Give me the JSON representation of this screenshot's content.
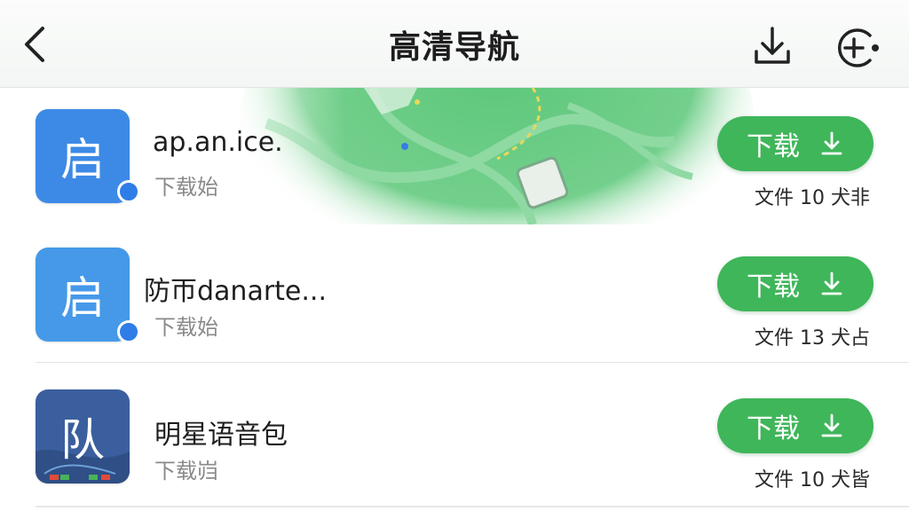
{
  "header": {
    "title": "高清导航",
    "back_icon": "chevron-left-icon",
    "download_icon": "download-tray-icon",
    "add_icon": "add-circle-icon"
  },
  "apps": [
    {
      "icon_char": "启",
      "icon_color": "#3d8ae6",
      "name": "ap.an.ice.",
      "subtitle": "下载始",
      "button_label": "下载",
      "size_text": "文件 10 犬非"
    },
    {
      "icon_char": "启",
      "icon_color": "#4599e8",
      "name": "防帀danarte...",
      "subtitle": "下载始",
      "button_label": "下载",
      "size_text": "文件 13 犬占"
    },
    {
      "icon_char": "队",
      "icon_color": "#3b5f9e",
      "name": "明星语音包",
      "subtitle": "下载岿",
      "button_label": "下载",
      "size_text": "文件 10 犬皆"
    }
  ],
  "colors": {
    "accent_green": "#3fb65a",
    "map_green": "#5cc77a",
    "badge_blue": "#2f7de6"
  }
}
